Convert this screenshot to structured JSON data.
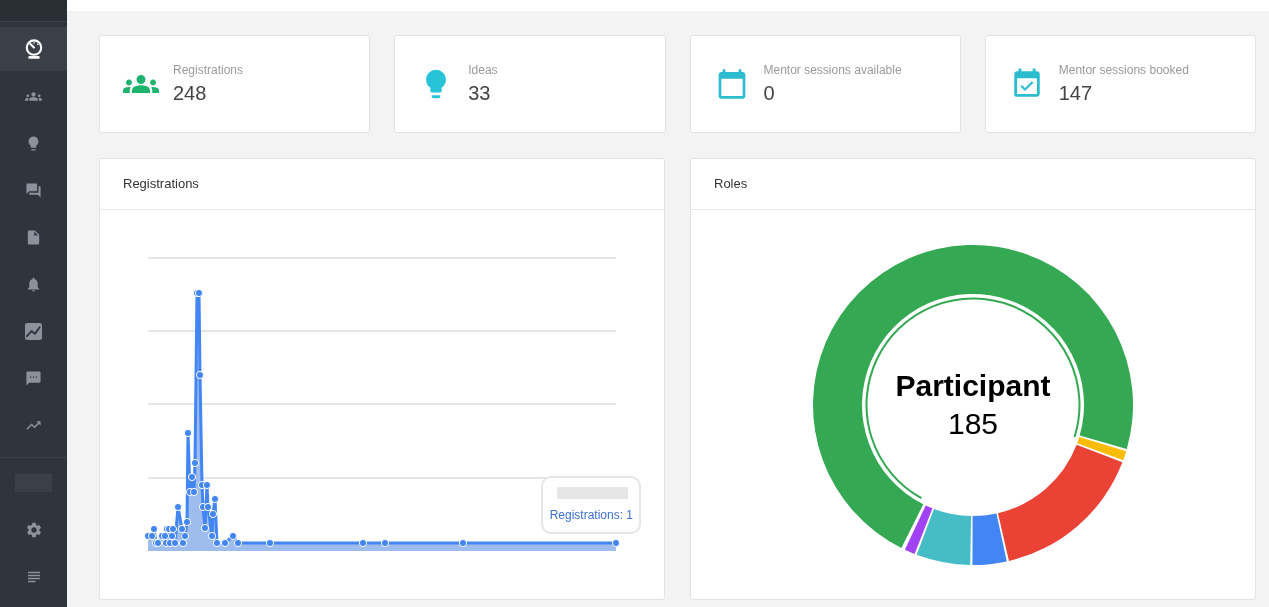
{
  "sidebar": {
    "items": [
      {
        "selected": true
      },
      {
        "selected": false
      },
      {
        "selected": false
      },
      {
        "selected": false
      },
      {
        "selected": false
      },
      {
        "selected": false
      },
      {
        "selected": false
      },
      {
        "selected": false
      },
      {
        "selected": false
      }
    ]
  },
  "stats": [
    {
      "label": "Registrations",
      "value": "248"
    },
    {
      "label": "Ideas",
      "value": "33"
    },
    {
      "label": "Mentor sessions available",
      "value": "0"
    },
    {
      "label": "Mentor sessions booked",
      "value": "147"
    }
  ],
  "registrations_panel": {
    "title": "Registrations",
    "tooltip": {
      "text": "Registrations: 1"
    }
  },
  "roles_panel": {
    "title": "Roles",
    "center_label": "Participant",
    "center_value": "185"
  }
}
